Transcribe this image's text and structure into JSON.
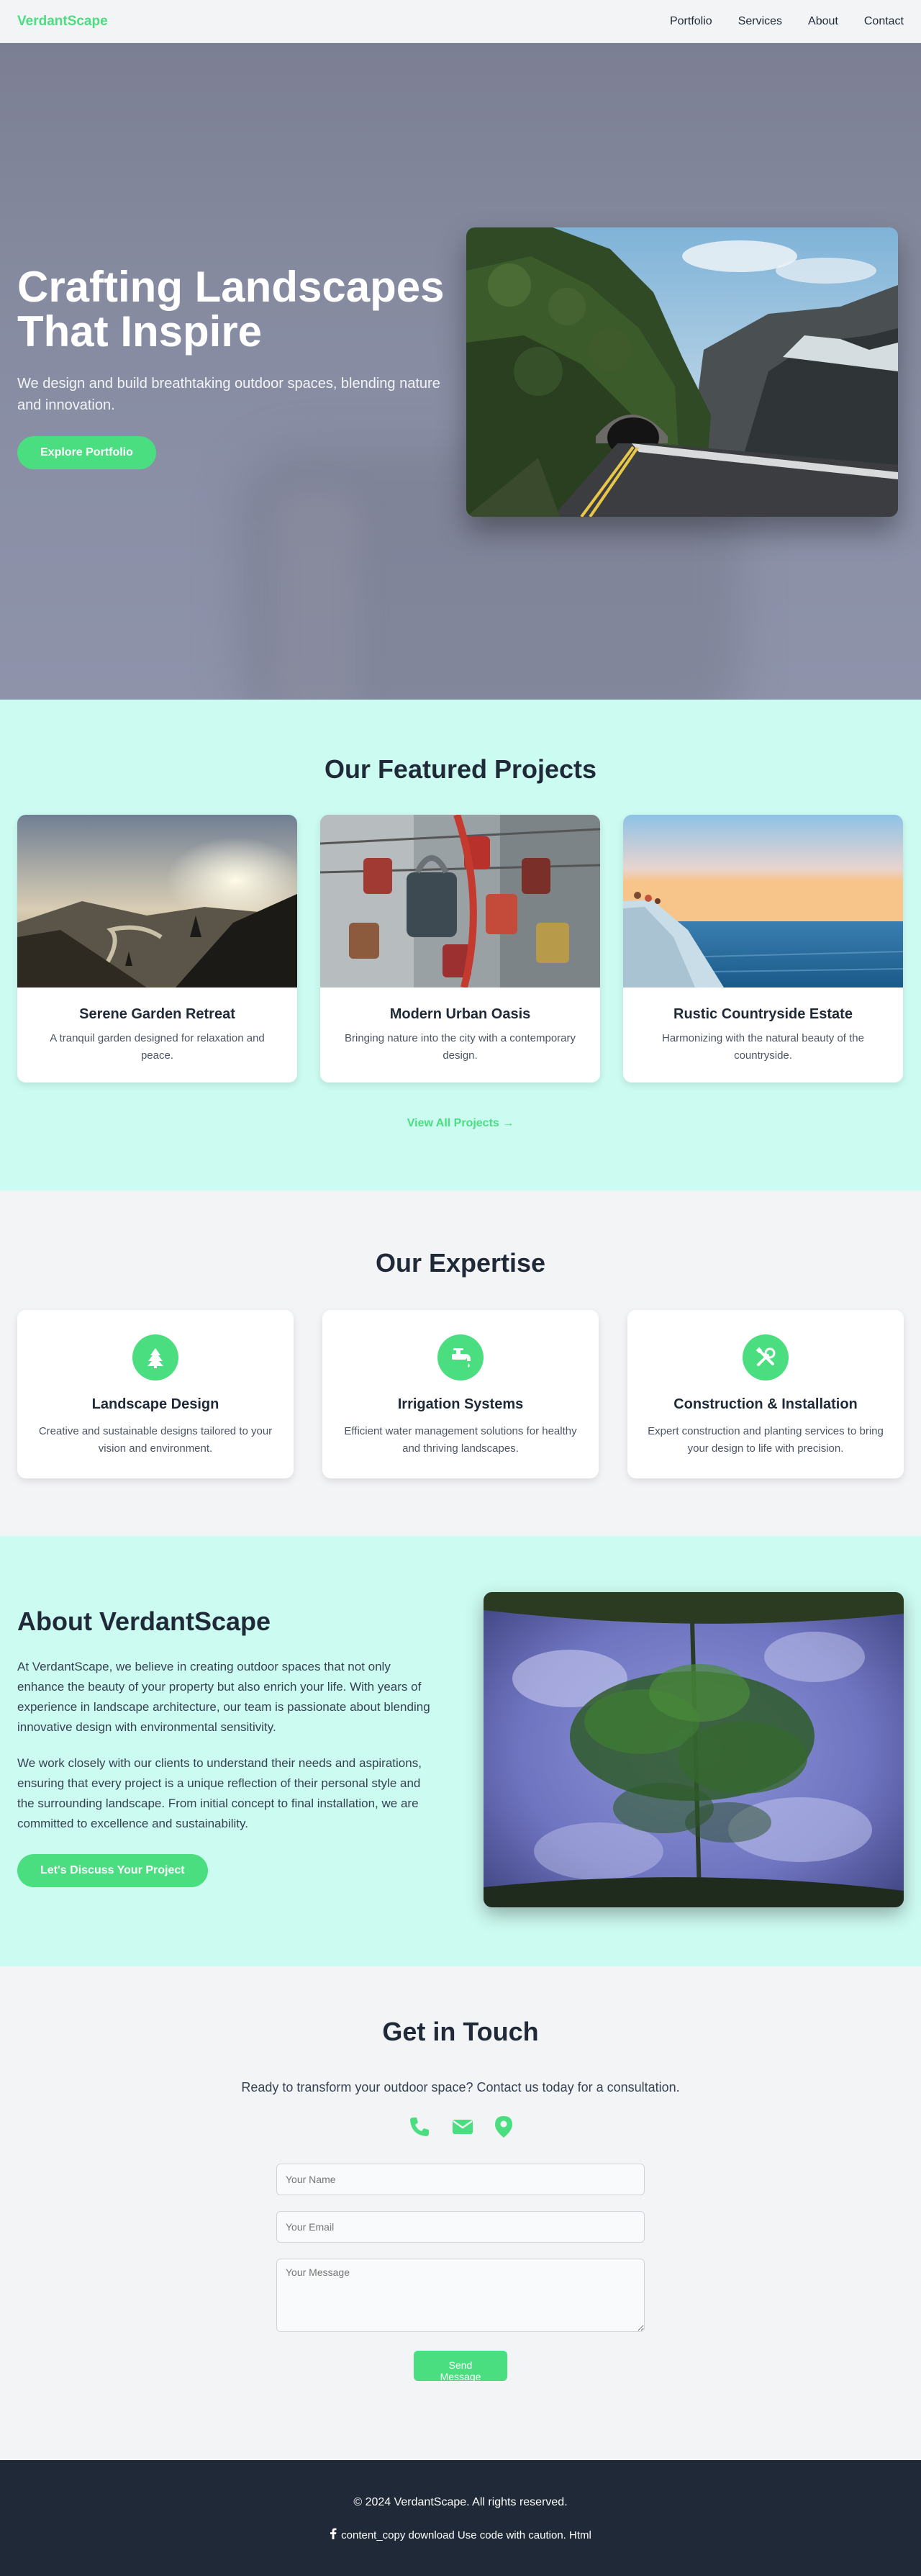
{
  "nav": {
    "brand": "VerdantScape",
    "links": [
      "Portfolio",
      "Services",
      "About",
      "Contact"
    ]
  },
  "hero": {
    "title_line1": "Crafting Landscapes",
    "title_line2": "That Inspire",
    "subtitle": "We design and build breathtaking outdoor spaces, blending nature and innovation.",
    "cta": "Explore Portfolio"
  },
  "projects": {
    "title": "Our Featured Projects",
    "items": [
      {
        "title": "Serene Garden Retreat",
        "desc": "A tranquil garden designed for relaxation and peace."
      },
      {
        "title": "Modern Urban Oasis",
        "desc": "Bringing nature into the city with a contemporary design."
      },
      {
        "title": "Rustic Countryside Estate",
        "desc": "Harmonizing with the natural beauty of the countryside."
      }
    ],
    "view_all": "View All Projects →"
  },
  "expertise": {
    "title": "Our Expertise",
    "items": [
      {
        "icon": "tree-icon",
        "title": "Landscape Design",
        "desc": "Creative and sustainable designs tailored to your vision and environment."
      },
      {
        "icon": "faucet-icon",
        "title": "Irrigation Systems",
        "desc": "Efficient water management solutions for healthy and thriving landscapes."
      },
      {
        "icon": "tools-icon",
        "title": "Construction & Installation",
        "desc": "Expert construction and planting services to bring your design to life with precision."
      }
    ]
  },
  "about": {
    "title": "About VerdantScape",
    "p1": "At VerdantScape, we believe in creating outdoor spaces that not only enhance the beauty of your property but also enrich your life. With years of experience in landscape architecture, our team is passionate about blending innovative design with environmental sensitivity.",
    "p2": "We work closely with our clients to understand their needs and aspirations, ensuring that every project is a unique reflection of their personal style and the surrounding landscape. From initial concept to final installation, we are committed to excellence and sustainability.",
    "cta": "Let's Discuss Your Project"
  },
  "contact": {
    "title": "Get in Touch",
    "subtitle": "Ready to transform your outdoor space? Contact us today for a consultation.",
    "name_placeholder": "Your Name",
    "email_placeholder": "Email",
    "email_placeholder_full": "Your Email",
    "message_placeholder": "Your Message",
    "send": "Send Message"
  },
  "footer": {
    "copyright": "© 2024 VerdantScape. All rights reserved.",
    "line": "content_copy download Use code with caution. Html"
  },
  "colors": {
    "accent": "#4ade80",
    "mint": "#ccfbf1",
    "dark": "#1f2937"
  }
}
